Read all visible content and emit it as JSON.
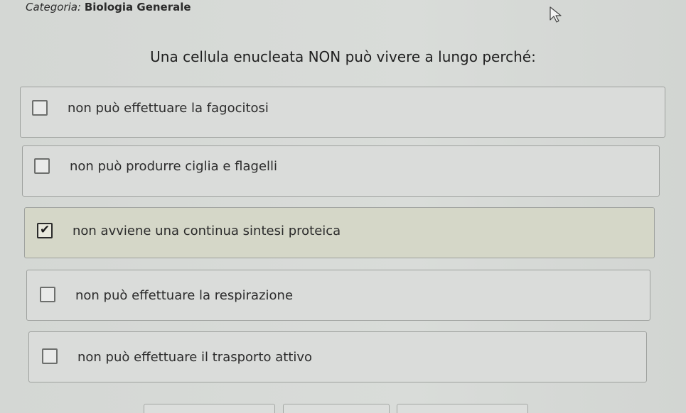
{
  "header": {
    "category_label": "Categoria:",
    "category_value": "Biologia Generale"
  },
  "question": {
    "text": "Una cellula enucleata NON può vivere a lungo perché:"
  },
  "options": [
    {
      "text": "non può effettuare la fagocitosi",
      "checked": false
    },
    {
      "text": "non può produrre ciglia e flagelli",
      "checked": false
    },
    {
      "text": "non avviene una continua sintesi proteica",
      "checked": true
    },
    {
      "text": "non può effettuare la respirazione",
      "checked": false
    },
    {
      "text": "non può effettuare il trasporto attivo",
      "checked": false
    }
  ],
  "icons": {
    "checkmark": "✔",
    "cursor": "arrow-cursor-icon"
  }
}
